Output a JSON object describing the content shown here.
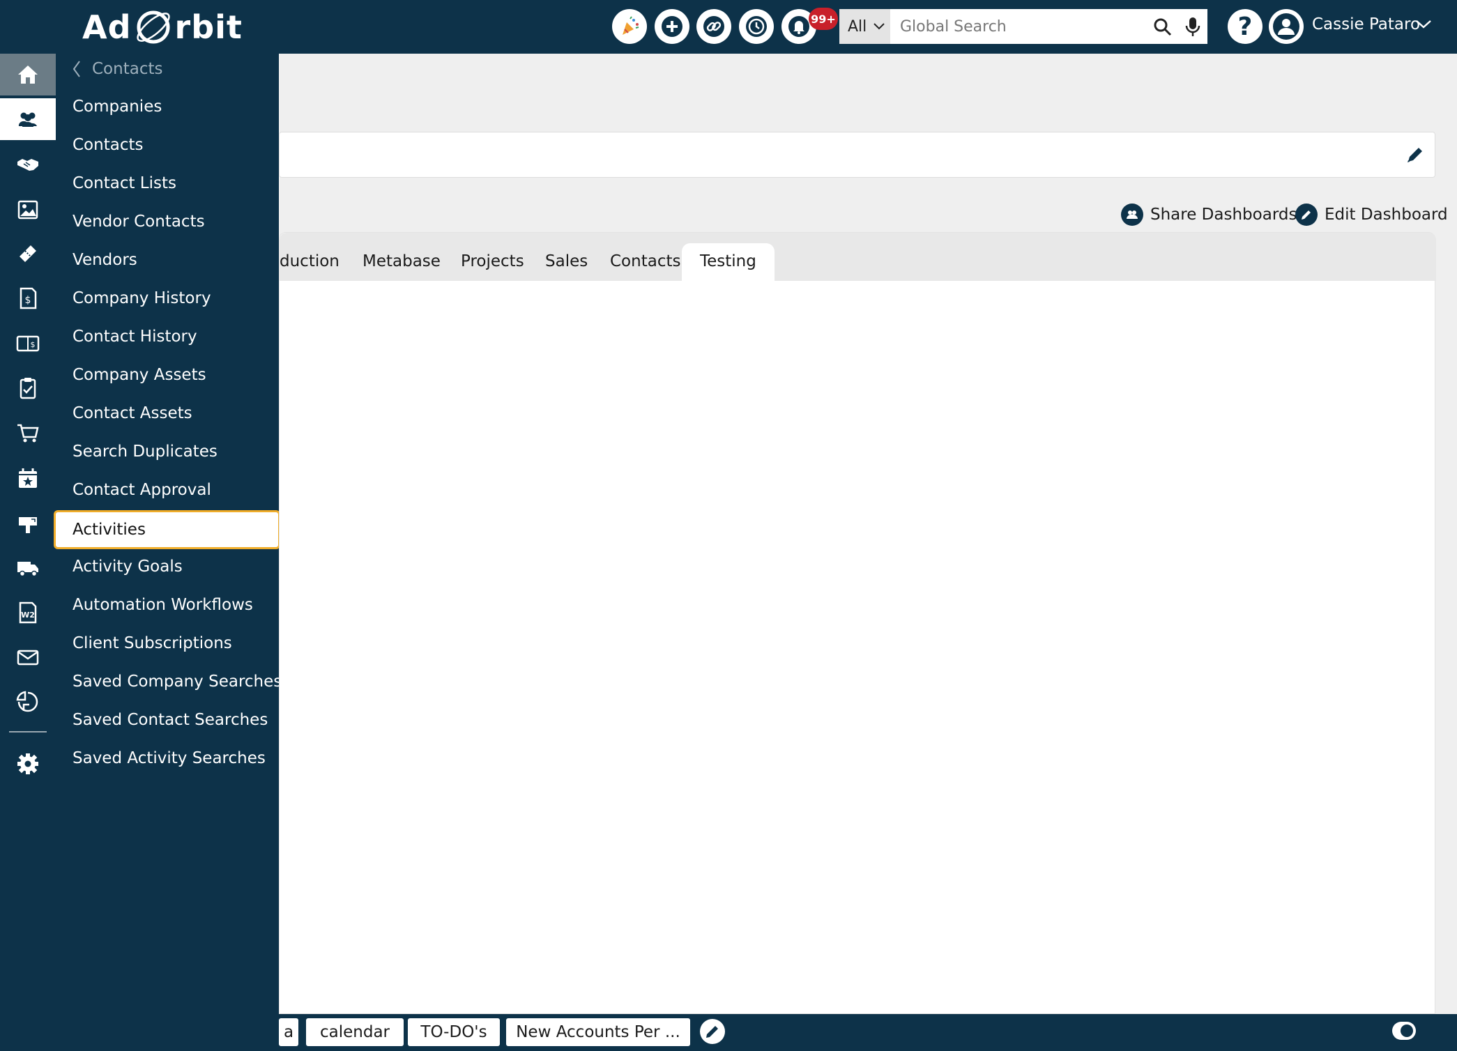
{
  "app": {
    "logo_text_left": "Ad",
    "logo_text_right": "rbit"
  },
  "topbar": {
    "notification_badge": "99+",
    "search": {
      "scope": "All",
      "placeholder": "Global Search"
    },
    "user_name": "Cassie Pataro"
  },
  "flyout": {
    "back_label": "Contacts",
    "items": [
      "Companies",
      "Contacts",
      "Contact Lists",
      "Vendor Contacts",
      "Vendors",
      "Company History",
      "Contact History",
      "Company Assets",
      "Contact Assets",
      "Search Duplicates",
      "Contact Approval",
      "Activities",
      "Activity Goals",
      "Automation Workflows",
      "Client Subscriptions",
      "Saved Company Searches",
      "Saved Contact Searches",
      "Saved Activity Searches"
    ],
    "highlighted_item": "Activities"
  },
  "dashboard": {
    "share_label": "Share Dashboards",
    "edit_label": "Edit Dashboard",
    "tabs": [
      "duction",
      "Metabase",
      "Projects",
      "Sales",
      "Contacts",
      "Testing"
    ],
    "active_tab": "Testing"
  },
  "bottombar": {
    "tabs": [
      "a",
      "calendar",
      "TO-DO's",
      "New Accounts Per ..."
    ]
  },
  "colors": {
    "navy": "#0d3249",
    "highlight_border": "#f0ad2a",
    "badge_red": "#c8202a"
  }
}
